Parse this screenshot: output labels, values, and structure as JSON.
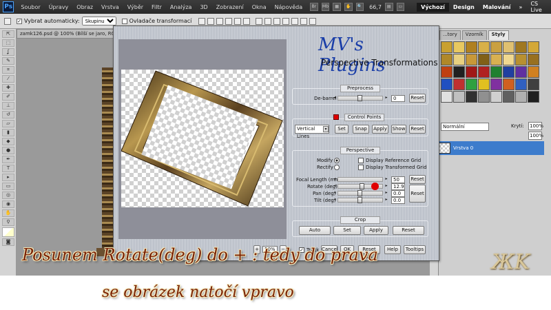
{
  "menubar": {
    "items": [
      "Soubor",
      "Úpravy",
      "Obraz",
      "Vrstva",
      "Výběr",
      "Filtr",
      "Analýza",
      "3D",
      "Zobrazení",
      "Okna",
      "Nápověda"
    ],
    "zoom": "66,7",
    "workspaces": [
      "Výchozí",
      "Design",
      "Malování"
    ],
    "cslive": "CS Live"
  },
  "options": {
    "auto_select_label": "Vybrat automaticky:",
    "auto_select_value": "Skupinu",
    "transform_label": "Ovladače transformací"
  },
  "doc": {
    "tab": "zamk126.psd @ 100% (Bílší se jaro, RGB/8)"
  },
  "panels": {
    "tabs": [
      "...tory",
      "Vzorník",
      "Styly"
    ],
    "blend": "Normální",
    "opacity_label": "Krytí:",
    "opacity_value": "100%",
    "fill_label": "",
    "fill_value": "100%",
    "layer_name": "Vrstva 0"
  },
  "plugin": {
    "brand": "MV's Plugins",
    "subtitle": "Perspective Transformations",
    "preprocess": {
      "title": "Preprocess",
      "debarrel_label": "De-barrel",
      "debarrel_value": "0",
      "reset": "Reset"
    },
    "control_points": {
      "title": "Control Points",
      "mode": "Vertical Lines",
      "buttons": [
        "Set",
        "Snap",
        "Apply",
        "Show",
        "Reset"
      ]
    },
    "perspective": {
      "title": "Perspective",
      "modify": "Modify",
      "rectify": "Rectify",
      "ref_grid": "Display Reference Grid",
      "trans_grid": "Display Transformed Grid",
      "rows": [
        {
          "label": "Focal Length (mm)",
          "value": "50"
        },
        {
          "label": "Rotate (deg)",
          "value": "12.9"
        },
        {
          "label": "Pan (deg)",
          "value": "0.0"
        },
        {
          "label": "Tilt (deg)",
          "value": "0.0"
        }
      ],
      "reset": "Reset",
      "reset2": "Reset"
    },
    "crop": {
      "title": "Crop",
      "buttons": [
        "Auto",
        "Set",
        "Apply",
        "Reset"
      ]
    },
    "zoom_value": "50%",
    "track_label": "Track",
    "footer": [
      "Cancel",
      "OK",
      "Reset All",
      "Help",
      "Tooltips"
    ]
  },
  "caption": {
    "line1": "Posunem Rotate(deg) do + : tedy do prava",
    "line2": "se obrázek natočí vpravo"
  },
  "seal_text": "ӁK",
  "colors": {
    "accent": "#3d7ccc",
    "brand_blue": "#1a3ea8",
    "caption_color": "#7a2206",
    "marker_red": "#e00000"
  }
}
